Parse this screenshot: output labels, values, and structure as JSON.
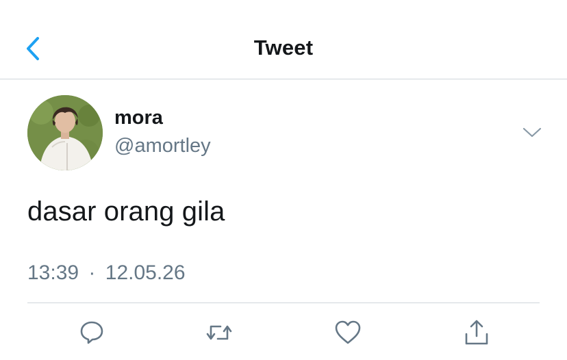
{
  "header": {
    "title": "Tweet",
    "back_icon": "chevron-left-icon",
    "accent_color": "#1da1f2"
  },
  "author": {
    "display_name": "mora",
    "username": "@amortley",
    "avatar": "profile-photo",
    "more_icon": "chevron-down-icon"
  },
  "tweet": {
    "text": "dasar orang gila",
    "time": "13:39",
    "separator": "·",
    "date": "12.05.26"
  },
  "actions": [
    {
      "name": "reply",
      "icon": "reply-icon"
    },
    {
      "name": "retweet",
      "icon": "retweet-icon"
    },
    {
      "name": "like",
      "icon": "heart-icon"
    },
    {
      "name": "share",
      "icon": "share-icon"
    }
  ],
  "colors": {
    "text": "#14171a",
    "secondary": "#657786",
    "divider": "#cfd5da",
    "accent": "#1da1f2"
  }
}
